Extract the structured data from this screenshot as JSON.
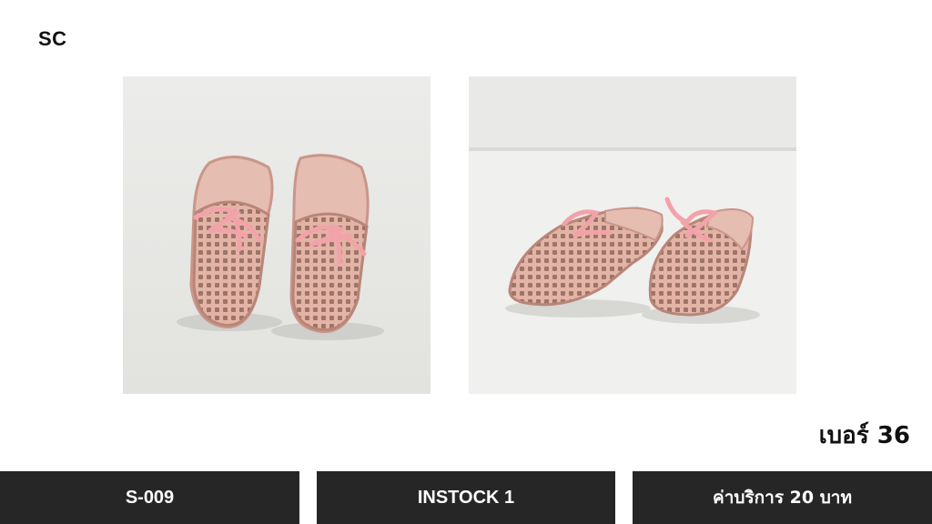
{
  "brand": "SC",
  "photos": [
    {
      "icon": "pink-woven-slippers-front-view"
    },
    {
      "icon": "pink-woven-slippers-side-view"
    }
  ],
  "size_label": "เบอร์ 36",
  "footer": {
    "code": "S-009",
    "stock": "INSTOCK 1",
    "fee": "ค่าบริการ 20 บาท"
  },
  "colors": {
    "bar": "#262626",
    "slipper": "#e8b8ad",
    "lace": "#f0a3a8"
  }
}
